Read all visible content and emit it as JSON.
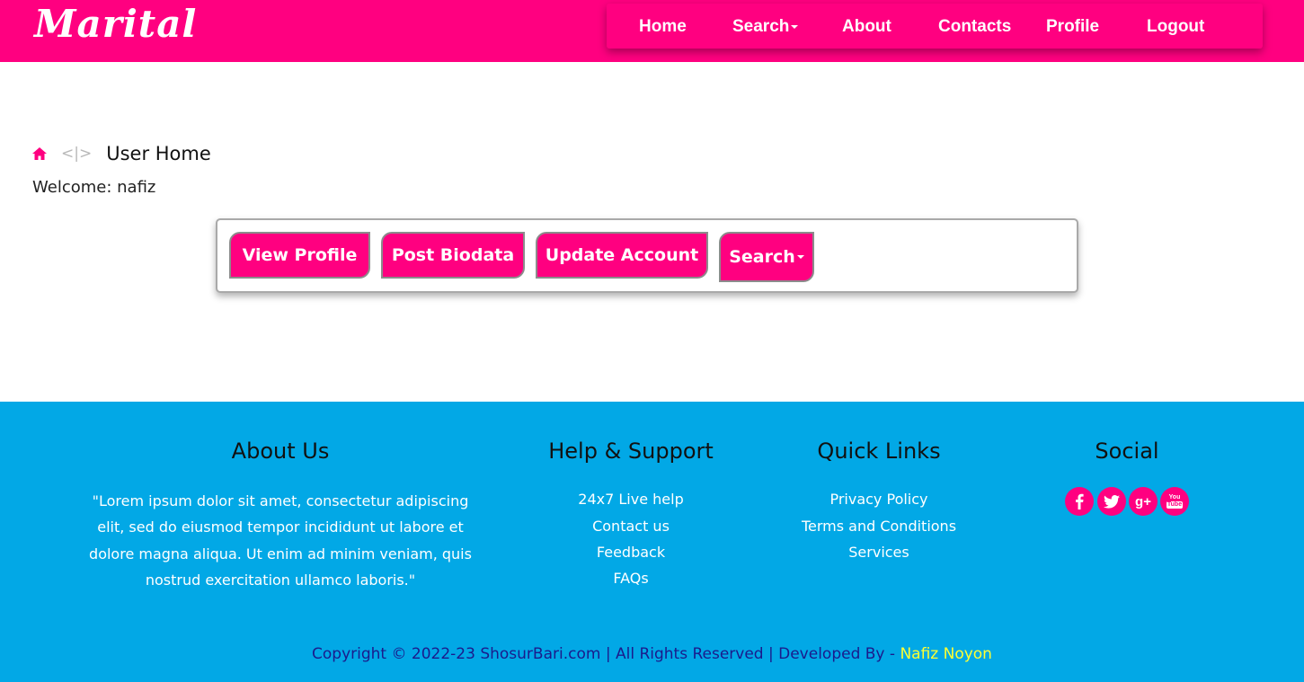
{
  "header": {
    "logo": "Marital",
    "nav": [
      {
        "label": "Home"
      },
      {
        "label": "Search",
        "dropdown": true
      },
      {
        "label": "About"
      },
      {
        "label": "Contacts"
      },
      {
        "label": "Profile"
      },
      {
        "label": "Logout"
      }
    ]
  },
  "breadcrumb": {
    "separator": "<|>",
    "title": "User Home"
  },
  "welcome": {
    "prefix": "Welcome:",
    "username": "nafiz"
  },
  "actions": [
    {
      "label": "View Profile"
    },
    {
      "label": "Post Biodata"
    },
    {
      "label": "Update Account"
    },
    {
      "label": "Search",
      "dropdown": true
    }
  ],
  "footer": {
    "about": {
      "heading": "About Us",
      "text": "\"Lorem ipsum dolor sit amet, consectetur adipiscing elit, sed do eiusmod tempor incididunt ut labore et dolore magna aliqua. Ut enim ad minim veniam, quis nostrud exercitation ullamco laboris.\""
    },
    "help": {
      "heading": "Help & Support",
      "links": [
        "24x7 Live help",
        "Contact us",
        "Feedback",
        "FAQs"
      ]
    },
    "quick": {
      "heading": "Quick Links",
      "links": [
        "Privacy Policy",
        "Terms and Conditions",
        "Services"
      ]
    },
    "social": {
      "heading": "Social",
      "icons": [
        "facebook-icon",
        "twitter-icon",
        "google-plus-icon",
        "youtube-icon"
      ]
    },
    "copyright": "Copyright © 2022-23 ShosurBari.com | All Rights Reserved | Developed By -",
    "developer": "Nafiz Noyon"
  },
  "colors": {
    "brand": "#ff0080",
    "footer_bg": "#02a8e6",
    "copyright_text": "#1b1b8c",
    "developer_text": "#ffff33"
  }
}
